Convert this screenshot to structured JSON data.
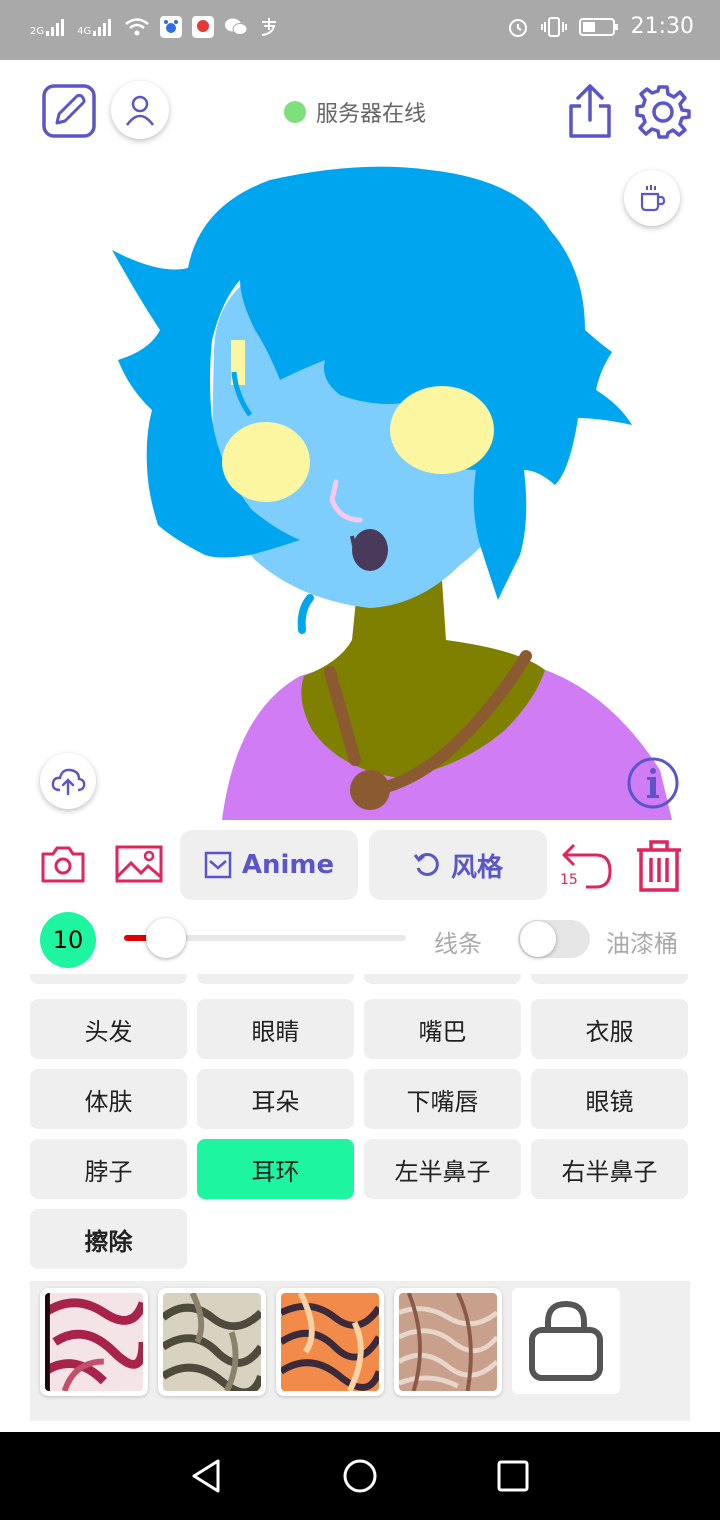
{
  "status_bar": {
    "network_1": "2G",
    "network_2": "4G",
    "time": "21:30"
  },
  "header": {
    "server_status": "服务器在线"
  },
  "toolbar": {
    "style_button_label": "Anime",
    "style_switch_label": "风格",
    "undo_count": "15"
  },
  "brush": {
    "size": "10",
    "line_label": "线条",
    "bucket_label": "油漆桶",
    "bucket_enabled": false
  },
  "parts": [
    {
      "label": "头发",
      "selected": false
    },
    {
      "label": "眼睛",
      "selected": false
    },
    {
      "label": "嘴巴",
      "selected": false
    },
    {
      "label": "衣服",
      "selected": false
    },
    {
      "label": "体肤",
      "selected": false
    },
    {
      "label": "耳朵",
      "selected": false
    },
    {
      "label": "下嘴唇",
      "selected": false
    },
    {
      "label": "眼镜",
      "selected": false
    },
    {
      "label": "脖子",
      "selected": false
    },
    {
      "label": "耳环",
      "selected": true
    },
    {
      "label": "左半鼻子",
      "selected": false
    },
    {
      "label": "右半鼻子",
      "selected": false
    },
    {
      "label": "擦除",
      "selected": false
    }
  ],
  "colors": {
    "accent": "#5a56c9",
    "danger": "#e0245e",
    "selected": "#1ef5a0",
    "online": "#7ee07b"
  }
}
